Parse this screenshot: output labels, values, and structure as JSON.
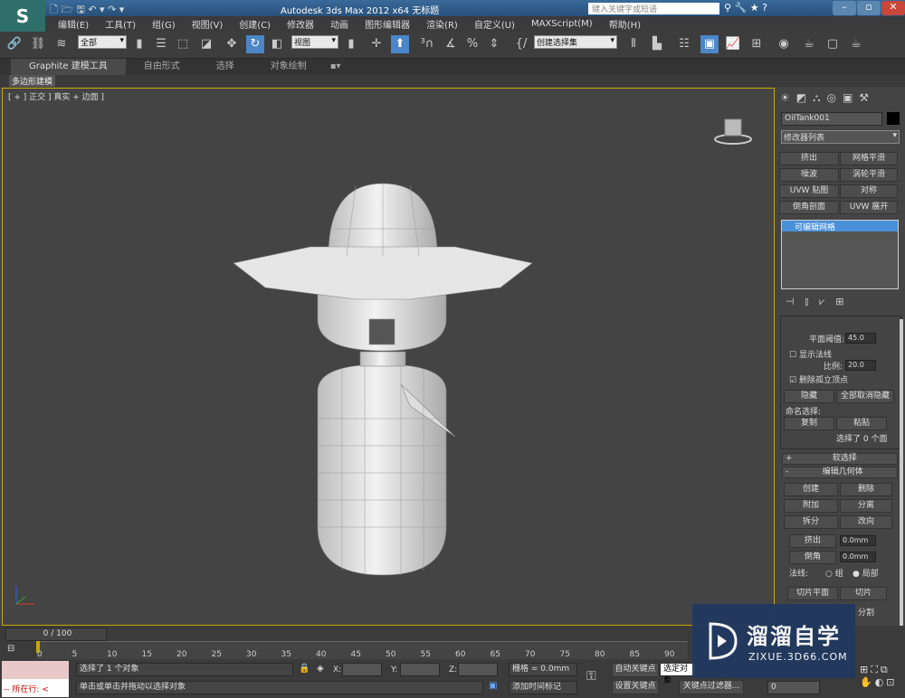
{
  "window": {
    "title": "Autodesk 3ds Max  2012 x64    无标题",
    "search_placeholder": "键入关键字或短语"
  },
  "menu": [
    "编辑(E)",
    "工具(T)",
    "组(G)",
    "视图(V)",
    "创建(C)",
    "修改器",
    "动画",
    "图形编辑器",
    "渲染(R)",
    "自定义(U)",
    "MAXScript(M)",
    "帮助(H)"
  ],
  "toolbar": {
    "selection_filter": "全部",
    "ref_coord": "视图",
    "named_selection": "创建选择集"
  },
  "ribbon": {
    "tabs": [
      "Graphite 建模工具",
      "自由形式",
      "选择",
      "对象绘制"
    ],
    "sub": "多边形建模"
  },
  "viewport": {
    "label": "[ + ] 正交 ] 真实 + 边面 ]"
  },
  "command": {
    "object_name": "OilTank001",
    "modifier_list": "修改器列表",
    "modifier_buttons": [
      "挤出",
      "网格平滑",
      "噪波",
      "涡轮平滑",
      "UVW 贴图",
      "对称",
      "倒角剖面",
      "UVW 展开"
    ],
    "stack_item": "可编辑网格",
    "planar_label": "平面阈值:",
    "planar_value": "45.0",
    "show_normals": "显示法线",
    "scale_label": "比例:",
    "scale_value": "20.0",
    "delete_isolated": "删除孤立顶点",
    "hide": "隐藏",
    "unhide_all": "全部取消隐藏",
    "named_sel": "命名选择:",
    "copy": "复制",
    "paste": "粘贴",
    "sel_count": "选择了 0 个面",
    "soft_sel": "软选择",
    "edit_geo": "编辑几何体",
    "geo_buttons": [
      "创建",
      "删除",
      "附加",
      "分离",
      "拆分",
      "改向"
    ],
    "extrude": "挤出",
    "extrude_value": "0.0mm",
    "bevel": "倒角",
    "bevel_value": "0.0mm",
    "normal_label": "法线:",
    "group": "组",
    "local": "局部",
    "slice_plane": "切片平面",
    "slice": "切片",
    "split": "分割"
  },
  "timeline": {
    "frame": "0 / 100",
    "ticks": [
      "0",
      "5",
      "10",
      "15",
      "20",
      "25",
      "30",
      "35",
      "40",
      "45",
      "50",
      "55",
      "60",
      "65",
      "70",
      "75",
      "80",
      "85",
      "90"
    ]
  },
  "status": {
    "script_label": "-- 所在行: <",
    "selected": "选择了 1 个对象",
    "hint": "单击或单击并拖动以选择对象",
    "x": "X:",
    "y": "Y:",
    "z": "Z:",
    "grid": "栅格 = 0.0mm",
    "add_tag": "添加时间标记",
    "auto_key": "自动关键点",
    "selected_mode": "选定对象",
    "set_key": "设置关键点",
    "key_filter": "关键点过滤器...",
    "frame_value": "0"
  },
  "watermark": {
    "name": "溜溜自学",
    "url": "ZIXUE.3D66.COM"
  }
}
